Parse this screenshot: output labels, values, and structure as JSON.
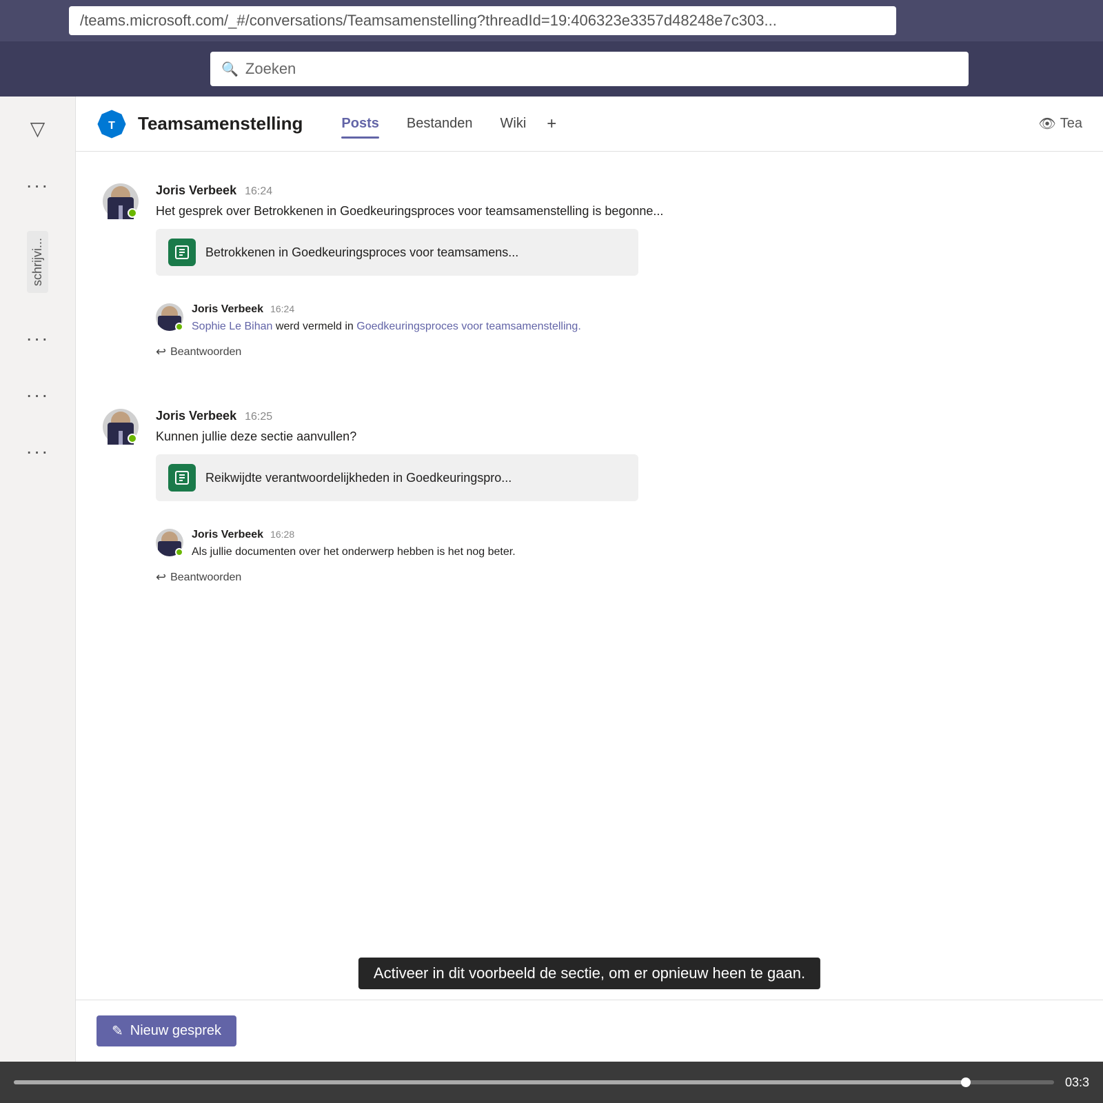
{
  "browser": {
    "url": "/teams.microsoft.com/_#/conversations/Teamsamenstelling?threadId=19:406323e3357d48248e7c303..."
  },
  "search": {
    "placeholder": "Zoeken"
  },
  "channel": {
    "name": "Teamsamenstelling",
    "tabs": [
      {
        "label": "Posts",
        "active": true
      },
      {
        "label": "Bestanden",
        "active": false
      },
      {
        "label": "Wiki",
        "active": false
      }
    ],
    "tab_plus": "+",
    "team_label": "Tea"
  },
  "sidebar": {
    "filter_icon": "▽",
    "items": [
      {
        "label": "...",
        "name": "dots-1"
      },
      {
        "label": "...",
        "name": "dots-2"
      },
      {
        "label": "...",
        "name": "dots-3"
      },
      {
        "label": "...",
        "name": "dots-4"
      },
      {
        "label": "schrijvi...",
        "name": "beschrijvi"
      }
    ]
  },
  "conversations": [
    {
      "id": "conv-1",
      "author": "Joris Verbeek",
      "time": "16:24",
      "message": "Het gesprek over Betrokkenen in Goedkeuringsproces voor teamsamenstelling is begonne...",
      "attachment": {
        "title": "Betrokkenen in Goedkeuringsproces voor teamsamens..."
      },
      "replies": [
        {
          "author": "Joris Verbeek",
          "time": "16:24",
          "text_before": "",
          "mention": "Sophie Le Bihan",
          "text_middle": " werd vermeld in ",
          "link": "Goedkeuringsproces voor teamsamenstelling.",
          "text_after": ""
        }
      ],
      "reply_button": "Beantwoorden"
    },
    {
      "id": "conv-2",
      "author": "Joris Verbeek",
      "time": "16:25",
      "message": "Kunnen jullie deze sectie aanvullen?",
      "attachment": {
        "title": "Reikwijdte verantwoordelijkheden in Goedkeuringspro..."
      },
      "replies": [
        {
          "author": "Joris Verbeek",
          "time": "16:28",
          "text": "Als jullie documenten over het onderwerp hebben is het nog beter.",
          "mention": null,
          "link": null
        }
      ],
      "reply_button": "Beantwoorden"
    }
  ],
  "subtitle": "Activeer in dit voorbeeld de sectie, om er opnieuw heen te gaan.",
  "new_conversation": {
    "label": "Nieuw gesprek",
    "icon": "✎"
  },
  "video": {
    "time": "03:3",
    "progress": 92
  }
}
